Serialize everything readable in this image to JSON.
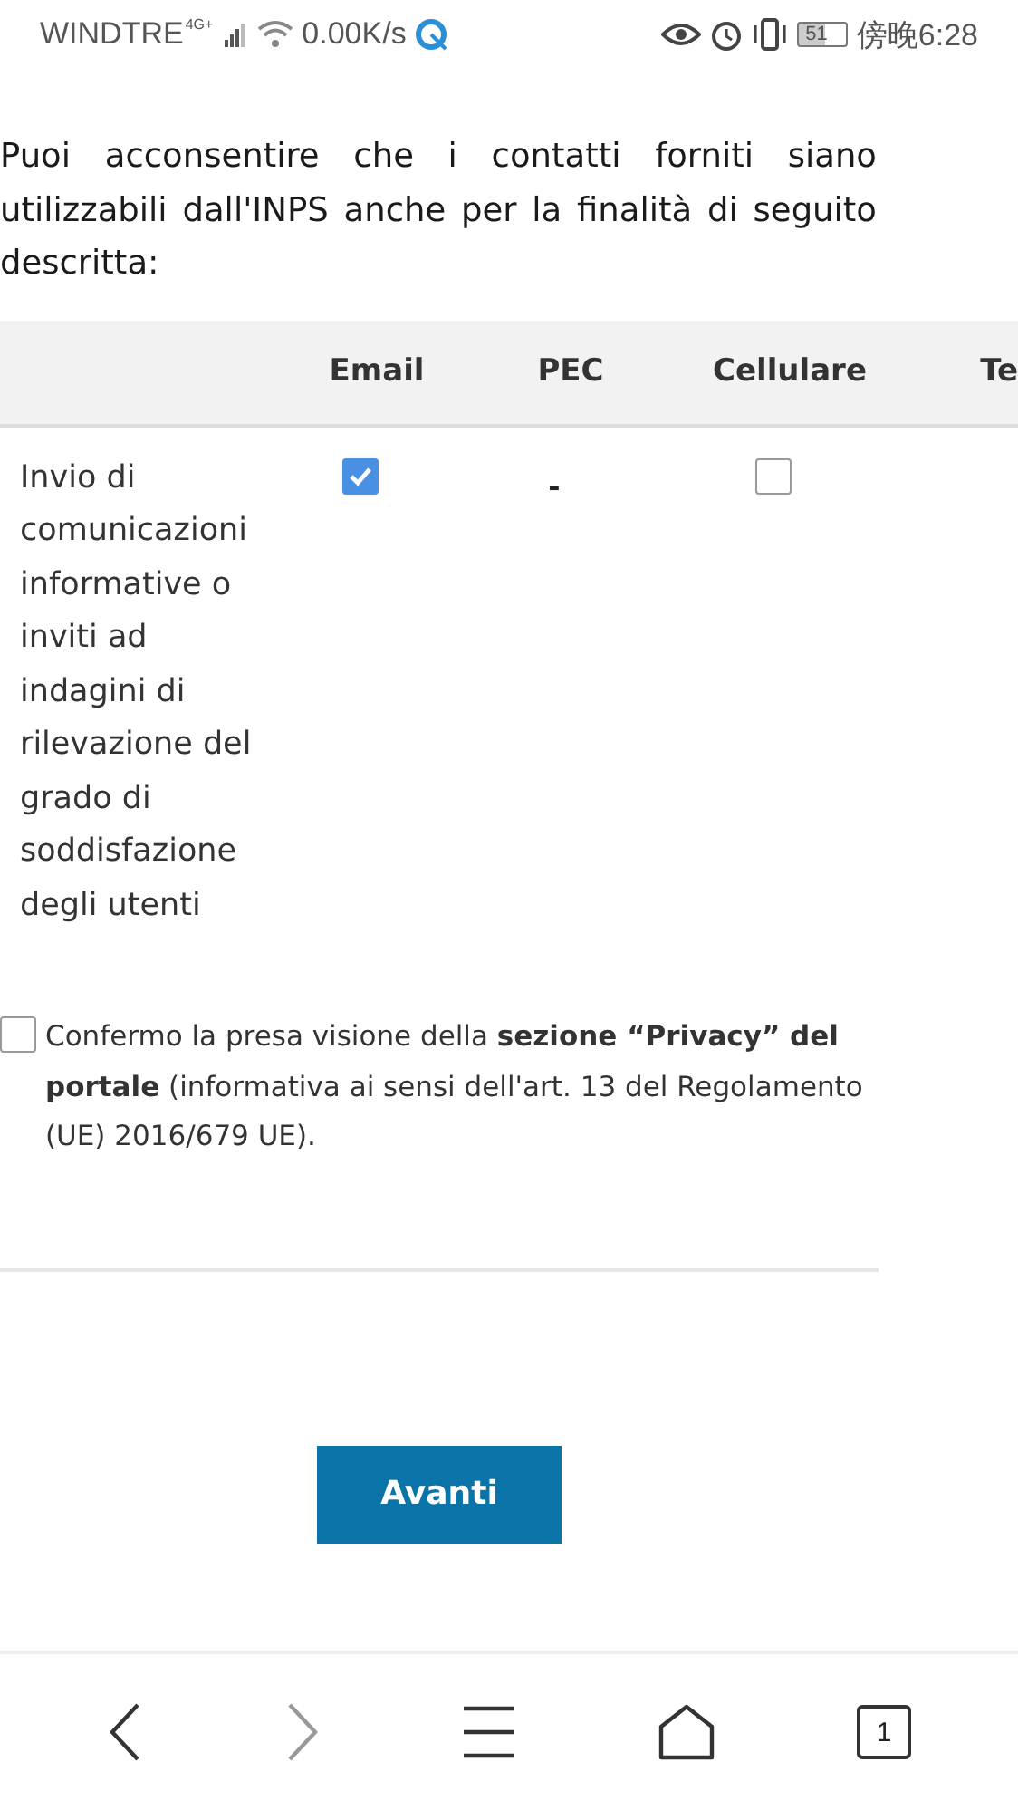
{
  "status_bar": {
    "carrier": "WINDTRE",
    "network": "4G+",
    "speed": "0.00K/s",
    "battery": "51",
    "time": "傍晚6:28"
  },
  "intro": "Puoi acconsentire che i contatti forniti siano utilizzabili dall'INPS anche per la finalità di seguito descritta:",
  "table": {
    "columns": [
      "Email",
      "PEC",
      "Cellulare",
      "Te"
    ],
    "rows": [
      {
        "label": "Invio di comunicazioni informative o inviti ad indagini di rilevazione del grado di soddisfazione degli utenti",
        "cells": [
          {
            "kind": "checkbox",
            "checked": true
          },
          {
            "kind": "text",
            "text": "-"
          },
          {
            "kind": "checkbox",
            "checked": false
          }
        ]
      }
    ]
  },
  "privacy": {
    "checked": false,
    "text": "Confermo la presa visione della **sezione “Privacy” del portale** (informativa ai sensi dell'art. 13 del Regolamento (UE) 2016/679 UE)."
  },
  "button": "Avanti",
  "nav": {
    "back_disabled": false,
    "forward_disabled": true,
    "tabs": "1"
  }
}
